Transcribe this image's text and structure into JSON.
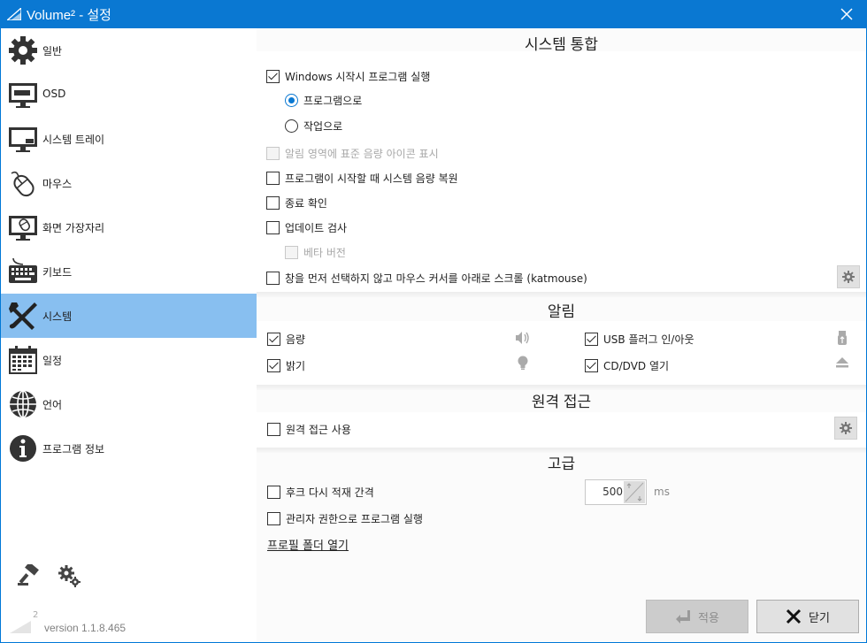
{
  "window": {
    "title": "Volume² - 설정"
  },
  "sidebar": {
    "items": [
      {
        "label": "일반",
        "icon": "gear-icon"
      },
      {
        "label": "OSD",
        "icon": "monitor-osd-icon"
      },
      {
        "label": "시스템 트레이",
        "icon": "monitor-tray-icon"
      },
      {
        "label": "마우스",
        "icon": "mouse-icon"
      },
      {
        "label": "화면 가장자리",
        "icon": "screen-edge-icon"
      },
      {
        "label": "키보드",
        "icon": "keyboard-icon"
      },
      {
        "label": "시스템",
        "icon": "tools-icon",
        "active": true
      },
      {
        "label": "일정",
        "icon": "calendar-icon"
      },
      {
        "label": "언어",
        "icon": "globe-icon"
      },
      {
        "label": "프로그램 정보",
        "icon": "info-icon"
      }
    ],
    "version_sup": "2",
    "version": "version 1.1.8.465"
  },
  "sections": {
    "integration": {
      "title": "시스템 통합",
      "run_at_startup": "Windows 시작시 프로그램 실행",
      "as_program": "프로그램으로",
      "as_task": "작업으로",
      "show_std_icon": "알림 영역에 표준 음량 아이콘 표시",
      "restore_volume": "프로그램이 시작할 때 시스템 음량 복원",
      "confirm_exit": "종료 확인",
      "check_updates": "업데이트 검사",
      "beta": "베타 버전",
      "katmouse": "창을 먼저 선택하지 않고 마우스 커서를 아래로 스크롤 (katmouse)"
    },
    "notifications": {
      "title": "알림",
      "volume": "음량",
      "brightness": "밝기",
      "usb": "USB 플러그 인/아웃",
      "cd": "CD/DVD 열기"
    },
    "remote": {
      "title": "원격 접근",
      "enable": "원격 접근 사용"
    },
    "advanced": {
      "title": "고급",
      "hook_interval": "후크 다시 적재 간격",
      "hook_value": "500",
      "hook_unit": "ms",
      "run_as_admin": "관리자 권한으로 프로그램 실행",
      "open_profile": "프로필 폴더 열기"
    }
  },
  "buttons": {
    "apply": "적용",
    "close": "닫기"
  },
  "colors": {
    "titlebar": "#0a78d2",
    "active_nav": "#88bff0",
    "radio_accent": "#0a78d2"
  }
}
